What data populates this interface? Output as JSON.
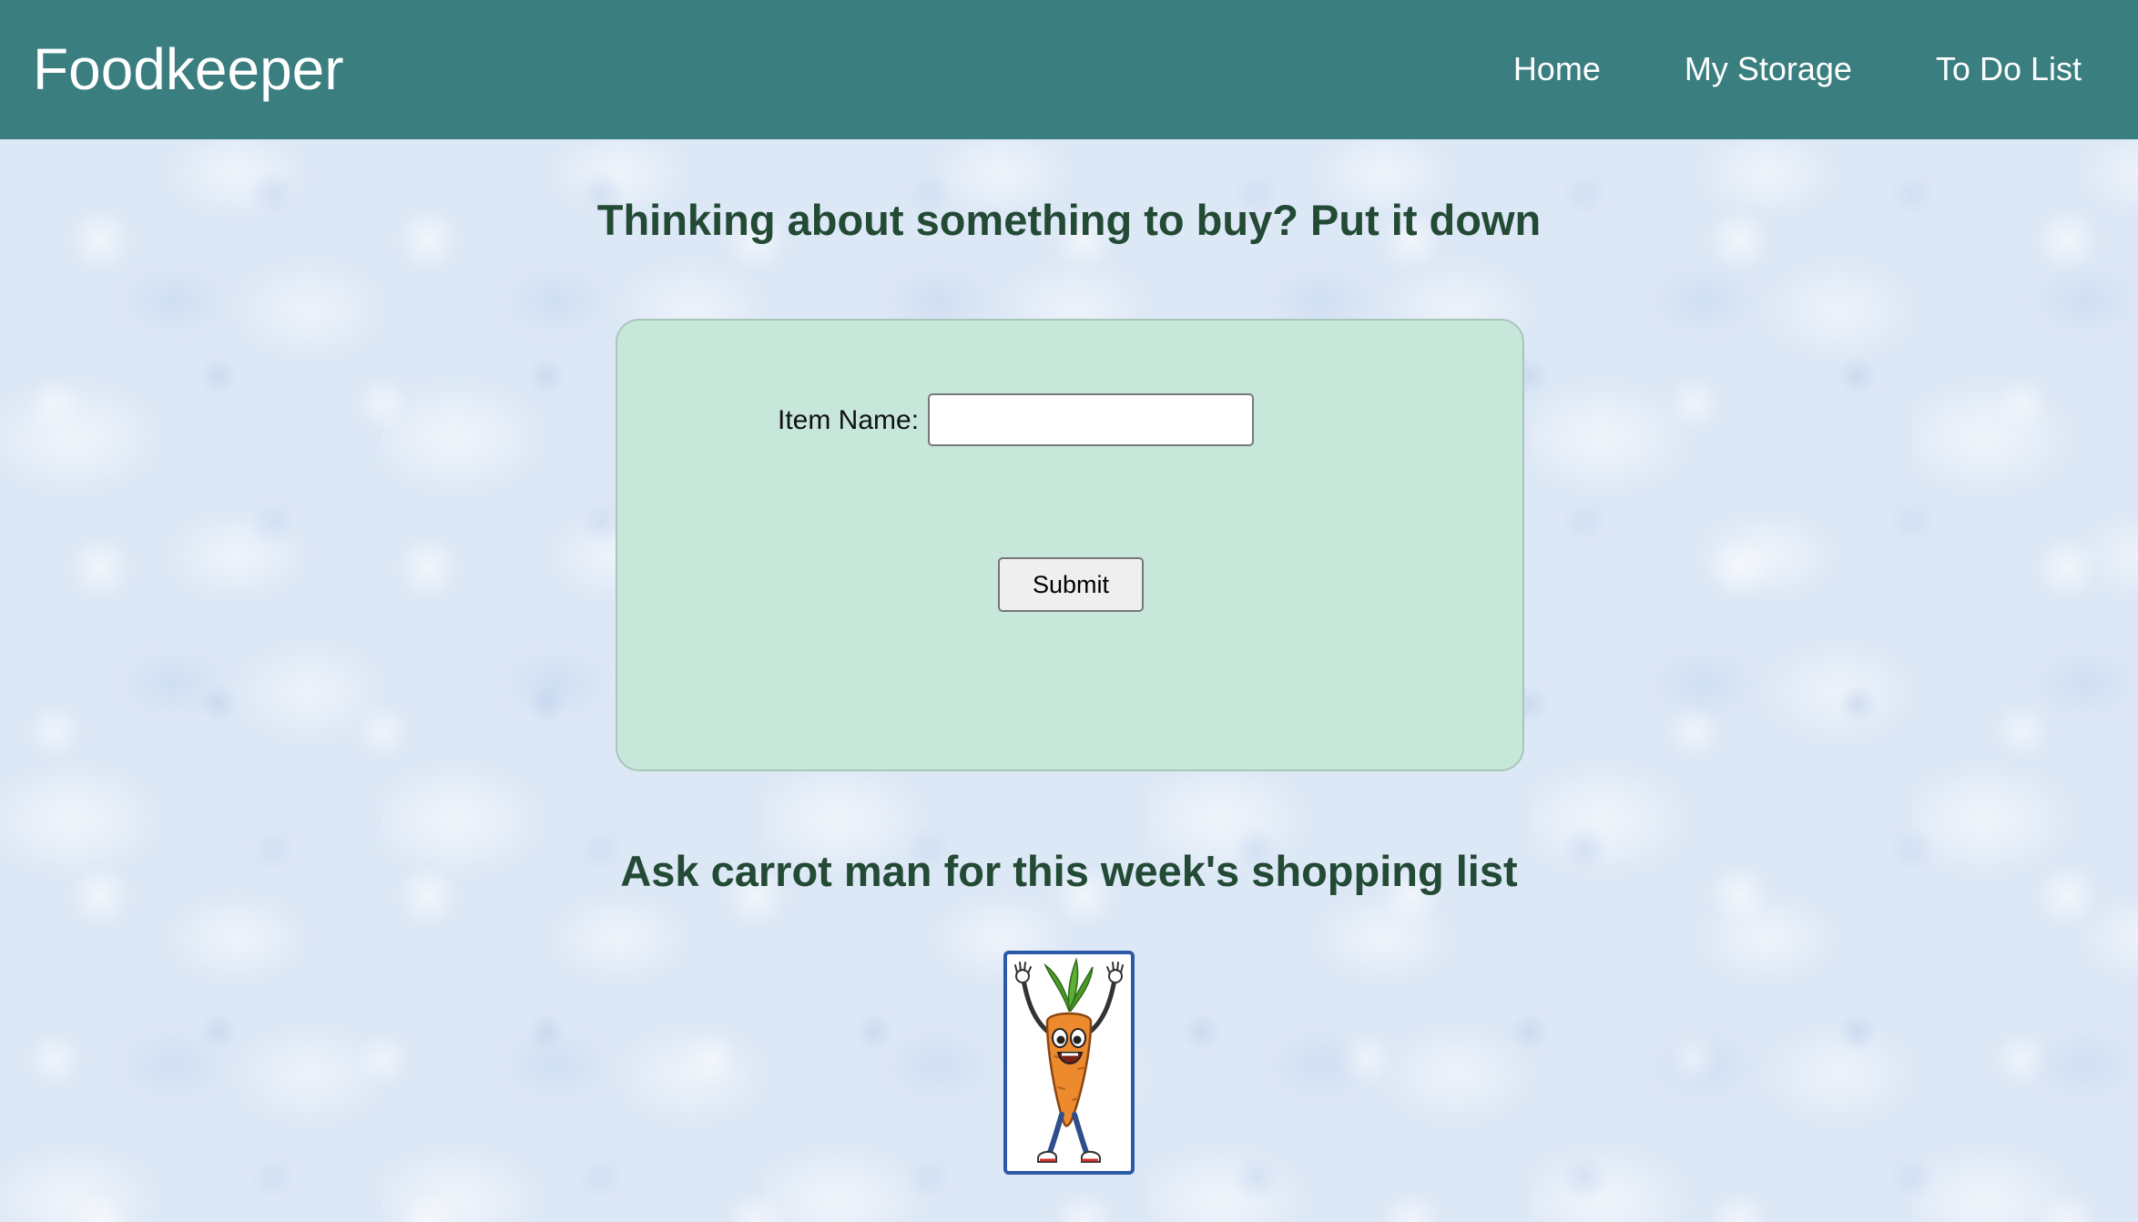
{
  "app": {
    "title": "Foodkeeper"
  },
  "nav": {
    "items": [
      {
        "label": "Home"
      },
      {
        "label": "My Storage"
      },
      {
        "label": "To Do List"
      }
    ]
  },
  "main": {
    "heading": "Thinking about something to buy? Put it down",
    "form": {
      "item_name_label": "Item Name:",
      "item_name_value": "",
      "submit_label": "Submit"
    },
    "carrot_heading": "Ask carrot man for this week's shopping list",
    "carrot_image": {
      "icon": "carrot-man-icon"
    }
  },
  "colors": {
    "header_bg": "#3a7e80",
    "heading_text": "#234a34",
    "card_bg": "#c6e7da",
    "page_bg": "#dde8f6",
    "image_border": "#2a5aa8"
  }
}
